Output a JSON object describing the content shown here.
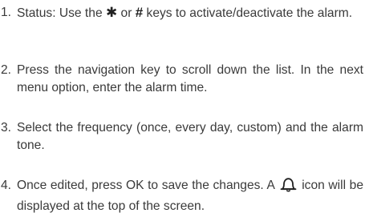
{
  "steps": [
    {
      "number": "1.",
      "before": "Status: Use the ",
      "key1": "✱",
      "middle": " or ",
      "key2": "#",
      "after": " keys to activate/deactivate the alarm."
    },
    {
      "number": "2.",
      "text": "Press the navigation key to scroll down the list. In the next menu option, enter the alarm time."
    },
    {
      "number": "3.",
      "text": "Select the frequency (once, every day, custom) and the alarm tone."
    },
    {
      "number": "4.",
      "before": "Once edited, press OK to save the changes. A ",
      "icon": "bell-icon",
      "after": " icon will be displayed at the top of the screen."
    }
  ],
  "colors": {
    "text": "#3a3a3a",
    "icon": "#222222"
  }
}
